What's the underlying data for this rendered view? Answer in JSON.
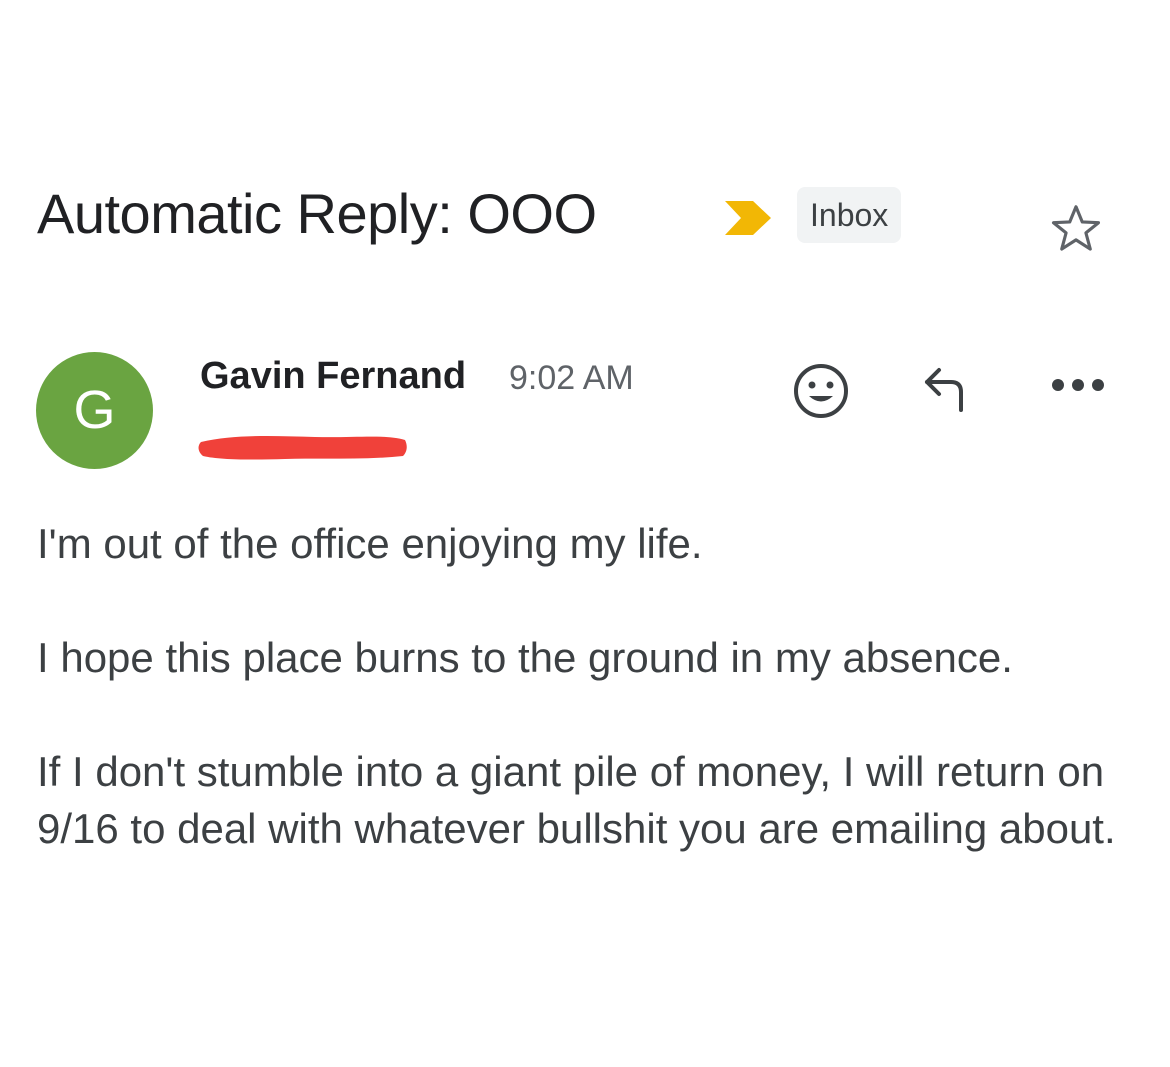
{
  "email": {
    "subject": "Automatic Reply: OOO",
    "label": "Inbox",
    "icons": {
      "importance": "importance-marker-icon",
      "star": "star-outline-icon",
      "emoji": "emoji-react-icon",
      "reply": "reply-icon",
      "more": "more-options-icon"
    },
    "sender": {
      "avatar_initial": "G",
      "avatar_color": "#6aa441",
      "name": "Gavin Fernand",
      "time": "9:02 AM"
    },
    "body": [
      "I'm out of the office enjoying my life.",
      "I hope this place burns to the ground in my absence.",
      "If I don't stumble into a giant pile of money, I will return on 9/16 to deal with whatever bullshit you are emailing about."
    ]
  },
  "colors": {
    "importance": "#f2b705",
    "redaction": "#f0413a",
    "chip_bg": "#f1f3f4"
  }
}
